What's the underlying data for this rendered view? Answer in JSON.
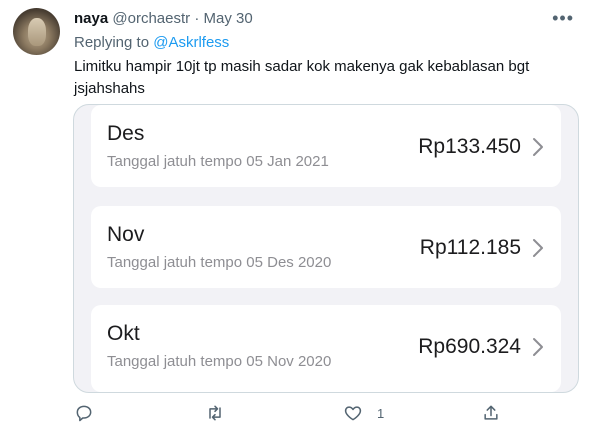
{
  "tweet": {
    "name": "naya",
    "handle": "@orchaestr",
    "separator": "·",
    "date": "May 30",
    "replying_prefix": "Replying to",
    "replying_mention": "@Askrlfess",
    "text_line1": "Limitku hampir 10jt tp masih sadar kok makenya gak kebablasan bgt",
    "text_line2": "jsjahshahs"
  },
  "bills": [
    {
      "month": "Des",
      "due": "Tanggal jatuh tempo 05 Jan 2021",
      "amount": "Rp133.450"
    },
    {
      "month": "Nov",
      "due": "Tanggal jatuh tempo 05 Des 2020",
      "amount": "Rp112.185"
    },
    {
      "month": "Okt",
      "due": "Tanggal jatuh tempo 05 Nov 2020",
      "amount": "Rp690.324"
    }
  ],
  "actions": {
    "reply_icon": "reply-icon",
    "retweet_icon": "retweet-icon",
    "like_icon": "heart-icon",
    "like_count": "1",
    "share_icon": "share-icon"
  },
  "colors": {
    "link": "#1d9bf0",
    "muted": "#536471",
    "media_bg": "#f2f2f6"
  }
}
